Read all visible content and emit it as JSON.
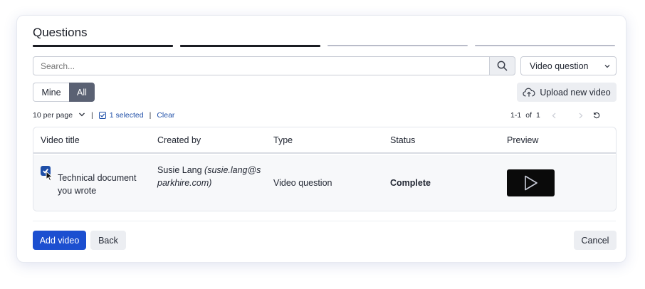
{
  "header": {
    "title": "Questions"
  },
  "progress": {
    "steps_total": 4,
    "steps_complete": 2
  },
  "search": {
    "placeholder": "Search...",
    "value": ""
  },
  "type_filter": {
    "selected": "Video question"
  },
  "scope": {
    "options": [
      "Mine",
      "All"
    ],
    "selected": "All"
  },
  "upload": {
    "label": "Upload new video"
  },
  "toolbar": {
    "per_page": "10 per page",
    "selected_count": "1 selected",
    "clear": "Clear"
  },
  "pager": {
    "range": "1-1",
    "of_label": "of",
    "total": "1"
  },
  "table": {
    "headers": [
      "Video title",
      "Created by",
      "Type",
      "Status",
      "Preview"
    ],
    "rows": [
      {
        "checked": true,
        "title": "Technical document you wrote",
        "creator_name": "Susie Lang",
        "creator_email": "(susie.lang@sparkhire.com)",
        "type": "Video question",
        "status": "Complete"
      }
    ]
  },
  "footer": {
    "add_label": "Add video",
    "back_label": "Back",
    "cancel_label": "Cancel"
  },
  "colors": {
    "primary": "#1c4fd0",
    "link": "#1f4fa8",
    "segment_active": "#5a6173",
    "step_done": "#1a1c22",
    "step_todo": "#b9bcc9"
  }
}
